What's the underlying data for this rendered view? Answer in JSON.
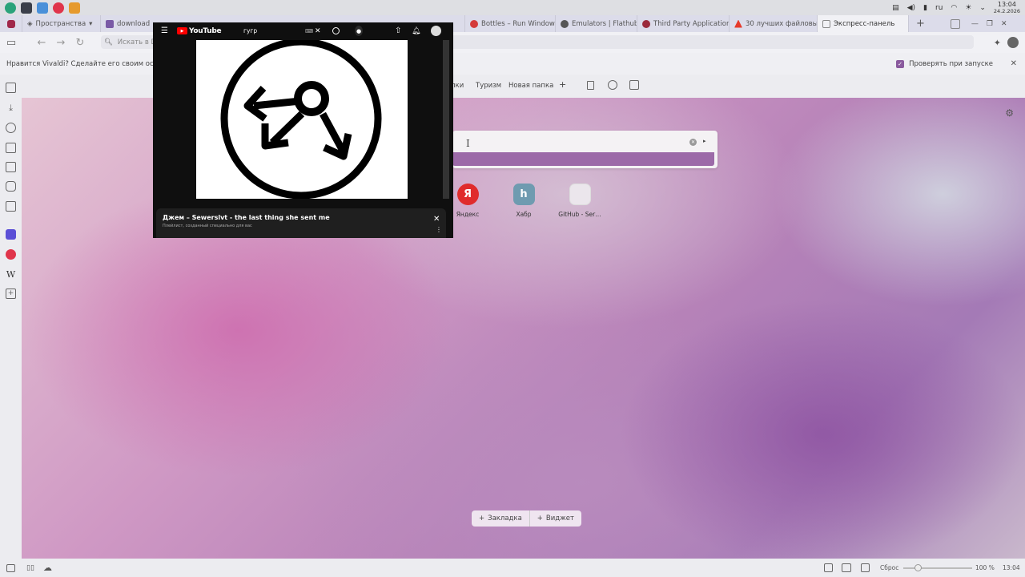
{
  "taskbar": {
    "language": "ru",
    "time": "13:04",
    "date": "24.2.2026"
  },
  "tabs": [
    {
      "label": "Пространства",
      "icon": "spaces-icon"
    },
    {
      "label": "download",
      "icon": "download-icon"
    },
    {
      "label": "Bottles – Run Window…",
      "icon": "bottles-icon"
    },
    {
      "label": "Emulators | Flathub",
      "icon": "flathub-icon"
    },
    {
      "label": "Third Party Application…",
      "icon": "app-icon"
    },
    {
      "label": "30 лучших файловых …",
      "icon": "warning-icon"
    },
    {
      "label": "Экспресс-панель",
      "icon": "speed-dial-icon",
      "active": true
    }
  ],
  "address": {
    "placeholder": "Искать в Du"
  },
  "notification": {
    "message": "Нравится Vivaldi? Сделайте его своим основн",
    "checkbox_label": "Проверять при запуске"
  },
  "bookmarks": [
    "пки",
    "Туризм",
    "Новая папка",
    "+"
  ],
  "speed_dial": [
    {
      "label": "Яндекс",
      "glyph": "Я",
      "color": "#e02c2c"
    },
    {
      "label": "Хабр",
      "glyph": "h",
      "color": "#6f9bb0"
    },
    {
      "label": "GitHub - Ser…",
      "glyph": "",
      "color": "#e8e4ea"
    }
  ],
  "page_buttons": {
    "bookmark": "Закладка",
    "widget": "Виджет"
  },
  "status": {
    "reset": "Сброс",
    "zoom": "100 %",
    "time": "13:04"
  },
  "youtube": {
    "brand": "YouTube",
    "search_query": "гугр",
    "title": "Джем – Sewerslvt - the last thing she sent me",
    "subtitle": "Плейлист, созданный специально для вас"
  },
  "colors": {
    "accent": "#9c6aa8",
    "youtube_red": "#ff0000"
  }
}
